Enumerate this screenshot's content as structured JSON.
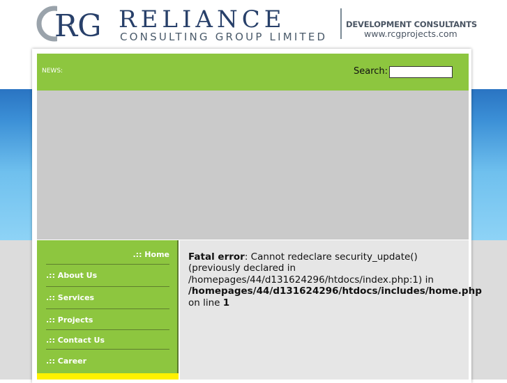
{
  "header": {
    "logo_letters": "RG",
    "brand_name": "RELIANCE",
    "brand_subtitle": "CONSULTING GROUP LIMITED",
    "dev_title": "DEVELOPMENT CONSULTANTS",
    "dev_url": "www.rcgprojects.com"
  },
  "topbar": {
    "news_label": "NEWS:",
    "search_label": "Search:",
    "search_value": ""
  },
  "nav": {
    "items": [
      {
        "label": ".:: Home"
      },
      {
        "label": ".:: About Us"
      },
      {
        "label": ".:: Services"
      },
      {
        "label": ".:: Projects"
      },
      {
        "label": ".:: Contact Us"
      },
      {
        "label": ".:: Career"
      }
    ]
  },
  "error": {
    "heading": "Fatal error",
    "message": ": Cannot redeclare security_update() (previously declared in /homepages/44/d131624296/htdocs/index.php:1) in",
    "path": "/homepages/44/d131624296/htdocs/includes/home.php",
    "line_prefix": "on line",
    "line_number": "1"
  },
  "colors": {
    "green": "#8dc63f",
    "brand_blue": "#28406a",
    "banner_grey": "#cacaca",
    "yellow": "#fff200"
  }
}
